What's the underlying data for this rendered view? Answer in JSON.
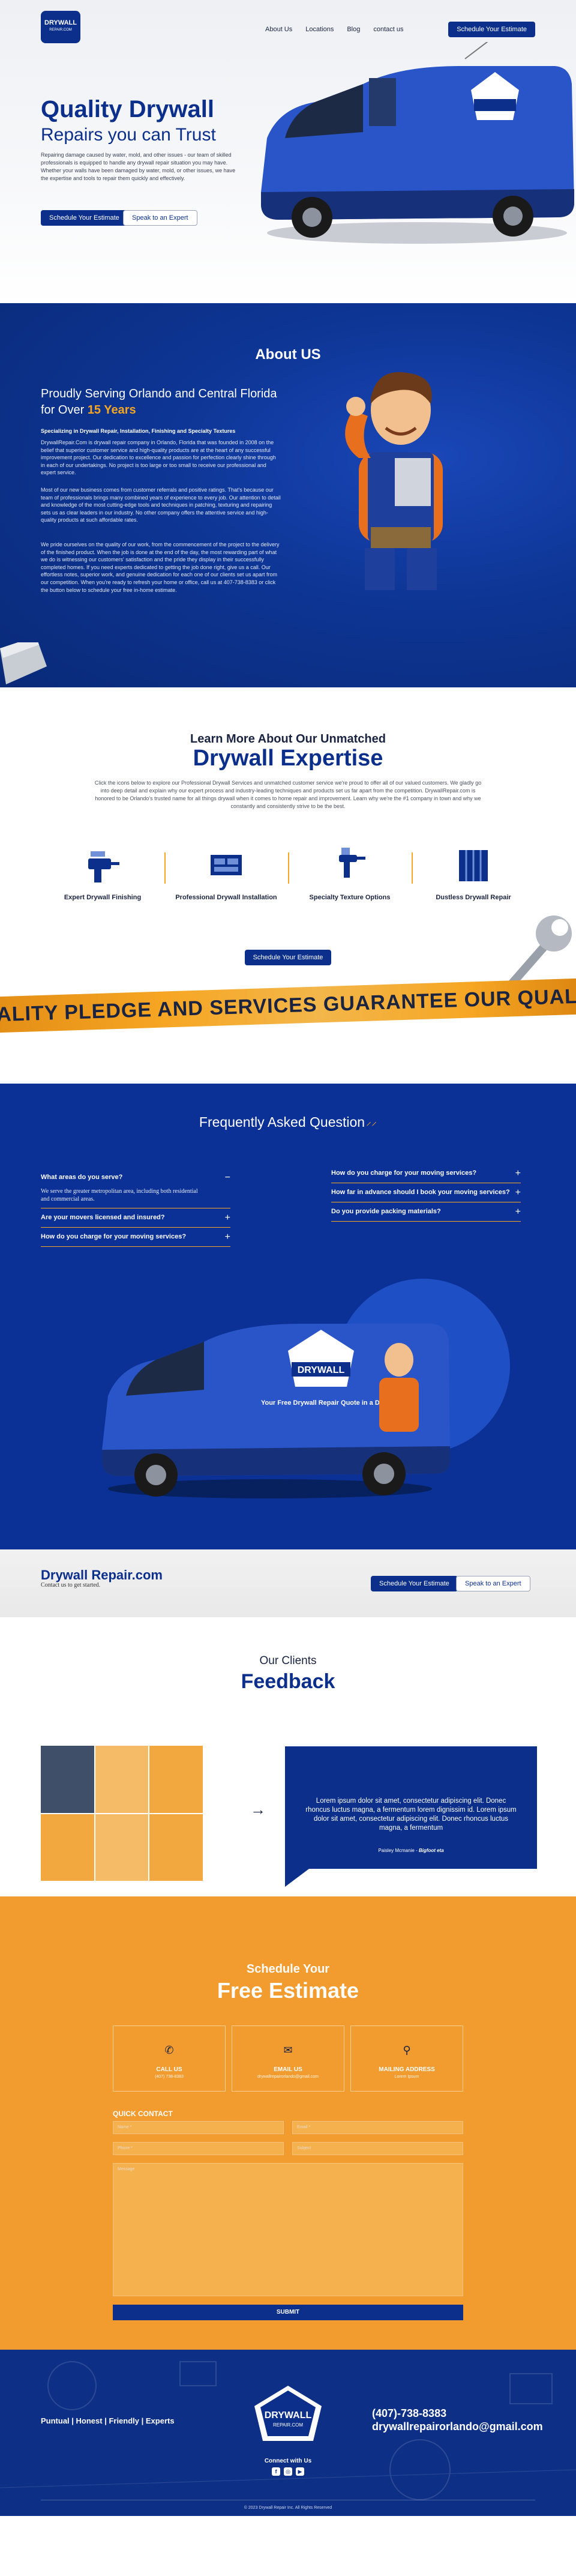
{
  "nav": {
    "logo_main": "DRYWALL",
    "logo_sub": "REPAIR.COM",
    "links": [
      "About Us",
      "Locations",
      "Blog",
      "contact us"
    ],
    "cta": "Schedule Your Estimate"
  },
  "hero": {
    "title": "Quality Drywall",
    "subtitle": "Repairs you can Trust",
    "body": "Repairing damage caused by water, mold, and other issues - our team of skilled professionals is equipped to handle any drywall repair situation you may have. Whether your walls have been damaged by water, mold, or other issues, we have the expertise and tools to repair them quickly and effectively.",
    "primary_button": "Schedule Your Estimate",
    "secondary_button": "Speak to an Expert"
  },
  "about": {
    "title": "About US",
    "heading": "Proudly Serving Orlando and Central Florida for Over",
    "heading_highlight": "15 Years",
    "subheading": "Specializing in Drywall Repair, Installation, Finishing and Specialty Textures",
    "p1": "DrywallRepair.Com is drywall repair company in Orlando, Florida that was founded in 2008 on the belief that superior customer service and high-quality products are at the heart of any successful improvement project. Our dedication to excellence and passion for perfection clearly shine through in each of our undertakings. No project is too large or too small to receive our professional and expert service.",
    "p2": "Most of our new business comes from customer referrals and positive ratings. That's because our team of professionals brings many combined years of experience to every job. Our attention to detail and knowledge of the most cutting-edge tools and techniques in patching, texturing and repairing sets us as clear leaders in our industry. No other company offers the attentive service and high-quality products at such affordable rates.",
    "p3": "We pride ourselves on the quality of our work, from the commencement of the project to the delivery of the finished product. When the job is done at the end of the day, the most rewarding part of what we do is witnessing our customers' satisfaction and the pride they display in their successfully completed homes. If you need experts dedicated to getting the job done right, give us a call. Our effortless notes, superior work, and genuine dedication for each one of our clients set us apart from our competition. When you're ready to refresh your home or office, call us at 407-738-8383 or click the button below to schedule your free in-home estimate."
  },
  "expertise": {
    "pre": "Learn More About Our Unmatched",
    "title": "Drywall Expertise",
    "desc": "Click the icons below to explore our Professional Drywall Services and unmatched customer service we're proud to offer all of our valued customers. We gladly go into deep detail and explain why our expert process and industry-leading techniques and products set us far apart from the competition. DrywallRepair.com is honored to be Orlando's trusted name for all things drywall when it comes to home repair and improvement. Learn why we're the #1 company in town and why we constantly and consistently strive to be the best.",
    "features": [
      {
        "label": "Expert Drywall Finishing",
        "icon": "drill-icon"
      },
      {
        "label": "Professional Drywall Installation",
        "icon": "drywall-panel-icon"
      },
      {
        "label": "Specialty Texture Options",
        "icon": "spray-gun-icon"
      },
      {
        "label": "Dustless Drywall Repair",
        "icon": "wall-grid-icon"
      }
    ],
    "cta": "Schedule Your Estimate",
    "banner": "QUALITY PLEDGE AND SERVICES GUARANTEE   OUR QUALITY"
  },
  "faq": {
    "title": "Frequently Asked Question",
    "left": [
      {
        "q": "What areas do you serve?",
        "sign": "−",
        "a": "We serve the greater metropolitan area, including both residential and commercial areas."
      },
      {
        "q": "Are your movers licensed and insured?",
        "sign": "+"
      },
      {
        "q": "How do you charge for your moving services?",
        "sign": "+"
      }
    ],
    "right": [
      {
        "q": "How do you charge for your moving services?",
        "sign": "+"
      },
      {
        "q": "How far in advance should I book your moving services?",
        "sign": "+"
      },
      {
        "q": "Do you provide packing materials?",
        "sign": "+"
      }
    ],
    "van_text": "Your Free Drywall Repair Quote in a Day"
  },
  "ctabar": {
    "brand": "Drywall Repair.com",
    "tag": "Contact us to get started.",
    "primary": "Schedule Your Estimate",
    "secondary": "Speak to an Expert"
  },
  "feedback": {
    "pre": "Our Clients",
    "title": "Feedback",
    "quote": "Lorem ipsum dolor sit amet, consectetur adipiscing elit. Donec rhoncus luctus magna, a fermentum lorem dignissim id. Lorem ipsum dolor sit amet, consectetur adipiscing elit. Donec rhoncus luctus magna, a fermentum",
    "author": "Paisley Mcmanie",
    "author_role": "Bigfoot eta"
  },
  "estimate": {
    "pre": "Schedule Your",
    "title": "Free Estimate",
    "cards": [
      {
        "icon": "phone-icon",
        "title": "CALL US",
        "value": "(407) 738-8383"
      },
      {
        "icon": "mail-icon",
        "title": "EMAIL US",
        "value": "drywallrepairorlando@gmail.com"
      },
      {
        "icon": "location-pin-icon",
        "title": "MAILING ADDRESS",
        "value": "Lorem Ipsum"
      }
    ],
    "quick_contact": "QUICK CONTACT",
    "fields": {
      "name": "Name *",
      "email": "Email *",
      "phone": "Phone *",
      "subject": "Subject",
      "message": "Message"
    },
    "submit": "SUBMIT"
  },
  "footer": {
    "left": "Puntual | Honest | Friendly | Experts",
    "phone": "(407)-738-8383",
    "email": "drywallrepairorlando@gmail.com",
    "connect": "Connect with Us",
    "socials": [
      "f",
      "◎",
      "▶"
    ],
    "copyright": "© 2023 Drywall Repair Inc. All Rights Reserved"
  },
  "colors": {
    "navy": "#0b2f8a",
    "orange": "#f6a623",
    "estimate_bg": "#f29b2f"
  }
}
